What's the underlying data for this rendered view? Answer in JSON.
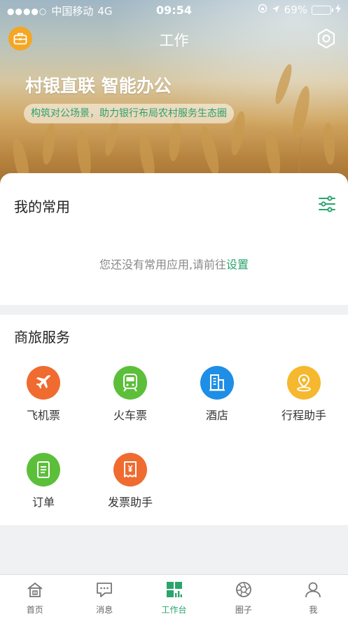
{
  "status_bar": {
    "signal_dots": "●●●●○",
    "carrier": "中国移动",
    "network": "4G",
    "time": "09:54",
    "battery_percent": "69%",
    "battery_level": 0.69
  },
  "header": {
    "title": "工作",
    "slogan": "村银直联 智能办公",
    "subslogan": "构筑对公场景，助力银行布局农村服务生态圈"
  },
  "common": {
    "title": "我的常用",
    "empty_text": "您还没有常用应用,请前往",
    "empty_link": "设置"
  },
  "travel": {
    "title": "商旅服务",
    "items": [
      {
        "label": "飞机票",
        "icon": "airplane-icon",
        "color": "#f06b2f"
      },
      {
        "label": "火车票",
        "icon": "train-icon",
        "color": "#5cbf3a"
      },
      {
        "label": "酒店",
        "icon": "hotel-icon",
        "color": "#1f8ee6"
      },
      {
        "label": "行程助手",
        "icon": "location-pin-icon",
        "color": "#f5b82e"
      },
      {
        "label": "订单",
        "icon": "order-list-icon",
        "color": "#5cbf3a"
      },
      {
        "label": "发票助手",
        "icon": "invoice-icon",
        "color": "#f06b2f"
      }
    ]
  },
  "tabbar": {
    "items": [
      {
        "label": "首页",
        "icon": "home-icon"
      },
      {
        "label": "消息",
        "icon": "message-icon"
      },
      {
        "label": "工作台",
        "icon": "workbench-icon",
        "active": true
      },
      {
        "label": "圈子",
        "icon": "aperture-icon"
      },
      {
        "label": "我",
        "icon": "profile-icon"
      }
    ]
  },
  "colors": {
    "accent": "#2aa46d",
    "briefcase": "#f5a623"
  }
}
